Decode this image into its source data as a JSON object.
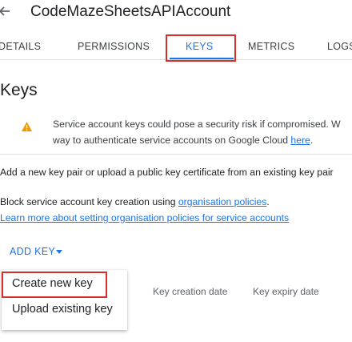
{
  "header": {
    "title": "CodeMazeSheetsAPIAccount",
    "back_icon": "arrow-left-icon"
  },
  "tabs": [
    {
      "label": "DETAILS"
    },
    {
      "label": "PERMISSIONS"
    },
    {
      "label": "KEYS",
      "active": true
    },
    {
      "label": "METRICS"
    },
    {
      "label": "LOGS"
    }
  ],
  "section_title": "Keys",
  "warning": {
    "icon": "warning-icon",
    "text_before_link": "Service account keys could pose a security risk if compromised. W",
    "text_line2": "way to authenticate service accounts on Google Cloud ",
    "link": "here",
    "text_after_link": "."
  },
  "add_key_pair_text": "Add a new key pair or upload a public key certificate from an existing key pair",
  "block_creation": {
    "text": "Block service account key creation using ",
    "link": "organisation policies",
    "suffix": "."
  },
  "learn_more_link": "Learn more about setting organisation policies for service accounts",
  "add_key": {
    "label": "ADD KEY",
    "caret_icon": "caret-down-icon"
  },
  "menu": {
    "items": [
      {
        "label": "Create new key"
      },
      {
        "label": "Upload existing key"
      }
    ]
  },
  "table": {
    "headers": [
      "Key creation date",
      "Key expiry date"
    ]
  },
  "colors": {
    "accent": "#1a73e8",
    "highlight": "#d62d2d",
    "warning": "#f29900"
  }
}
